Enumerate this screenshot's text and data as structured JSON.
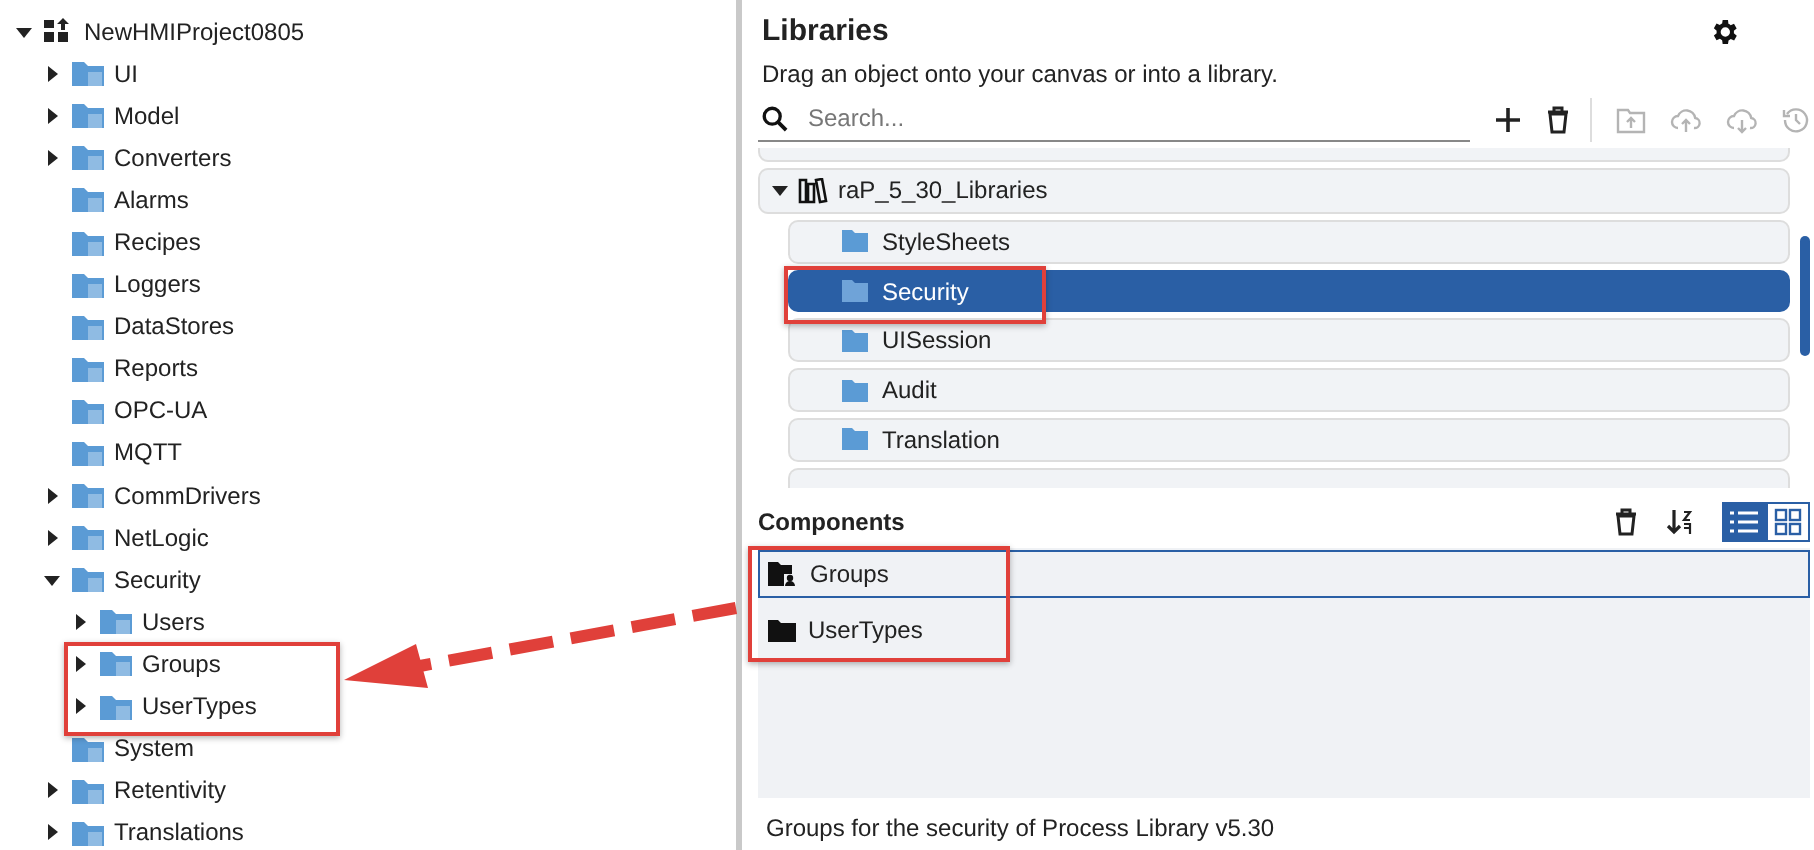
{
  "tree": {
    "label": "NewHMIProject0805",
    "expanded": true,
    "children": [
      {
        "label": "UI",
        "expanded": false
      },
      {
        "label": "Model",
        "expanded": false
      },
      {
        "label": "Converters",
        "expanded": false
      },
      {
        "label": "Alarms"
      },
      {
        "label": "Recipes"
      },
      {
        "label": "Loggers"
      },
      {
        "label": "DataStores"
      },
      {
        "label": "Reports"
      },
      {
        "label": "OPC-UA"
      },
      {
        "label": "MQTT"
      },
      {
        "label": "CommDrivers",
        "expanded": false
      },
      {
        "label": "NetLogic",
        "expanded": false
      },
      {
        "label": "Security",
        "expanded": true,
        "children": [
          {
            "label": "Users",
            "expanded": false
          },
          {
            "label": "Groups",
            "expanded": false
          },
          {
            "label": "UserTypes",
            "expanded": false
          }
        ]
      },
      {
        "label": "System"
      },
      {
        "label": "Retentivity",
        "expanded": false
      },
      {
        "label": "Translations",
        "expanded": false
      }
    ]
  },
  "libraries": {
    "title": "Libraries",
    "subtitle": "Drag an object onto your canvas or into a library.",
    "search": {
      "placeholder": "Search..."
    },
    "toolbar": [
      {
        "kind": "add",
        "disabled": false
      },
      {
        "kind": "delete",
        "disabled": false
      },
      {
        "kind": "import",
        "disabled": true
      },
      {
        "kind": "upload",
        "disabled": true
      },
      {
        "kind": "download",
        "disabled": true
      },
      {
        "kind": "history",
        "disabled": true
      }
    ],
    "groups": [
      {
        "label": "raP_5_30_Libraries",
        "expanded": true,
        "children": [
          {
            "label": "StyleSheets",
            "selected": false
          },
          {
            "label": "Security",
            "selected": true
          },
          {
            "label": "UISession",
            "selected": false
          },
          {
            "label": "Audit",
            "selected": false
          },
          {
            "label": "Translation",
            "selected": false
          }
        ]
      }
    ]
  },
  "components": {
    "title": "Components",
    "view_buttons": [
      {
        "kind": "list",
        "selected": true
      },
      {
        "kind": "grid",
        "selected": false
      }
    ],
    "items": [
      {
        "label": "Groups",
        "kind": "group",
        "selected": true
      },
      {
        "label": "UserTypes",
        "kind": "folder",
        "selected": false
      }
    ],
    "description": "Groups for the security of Process Library v5.30"
  }
}
